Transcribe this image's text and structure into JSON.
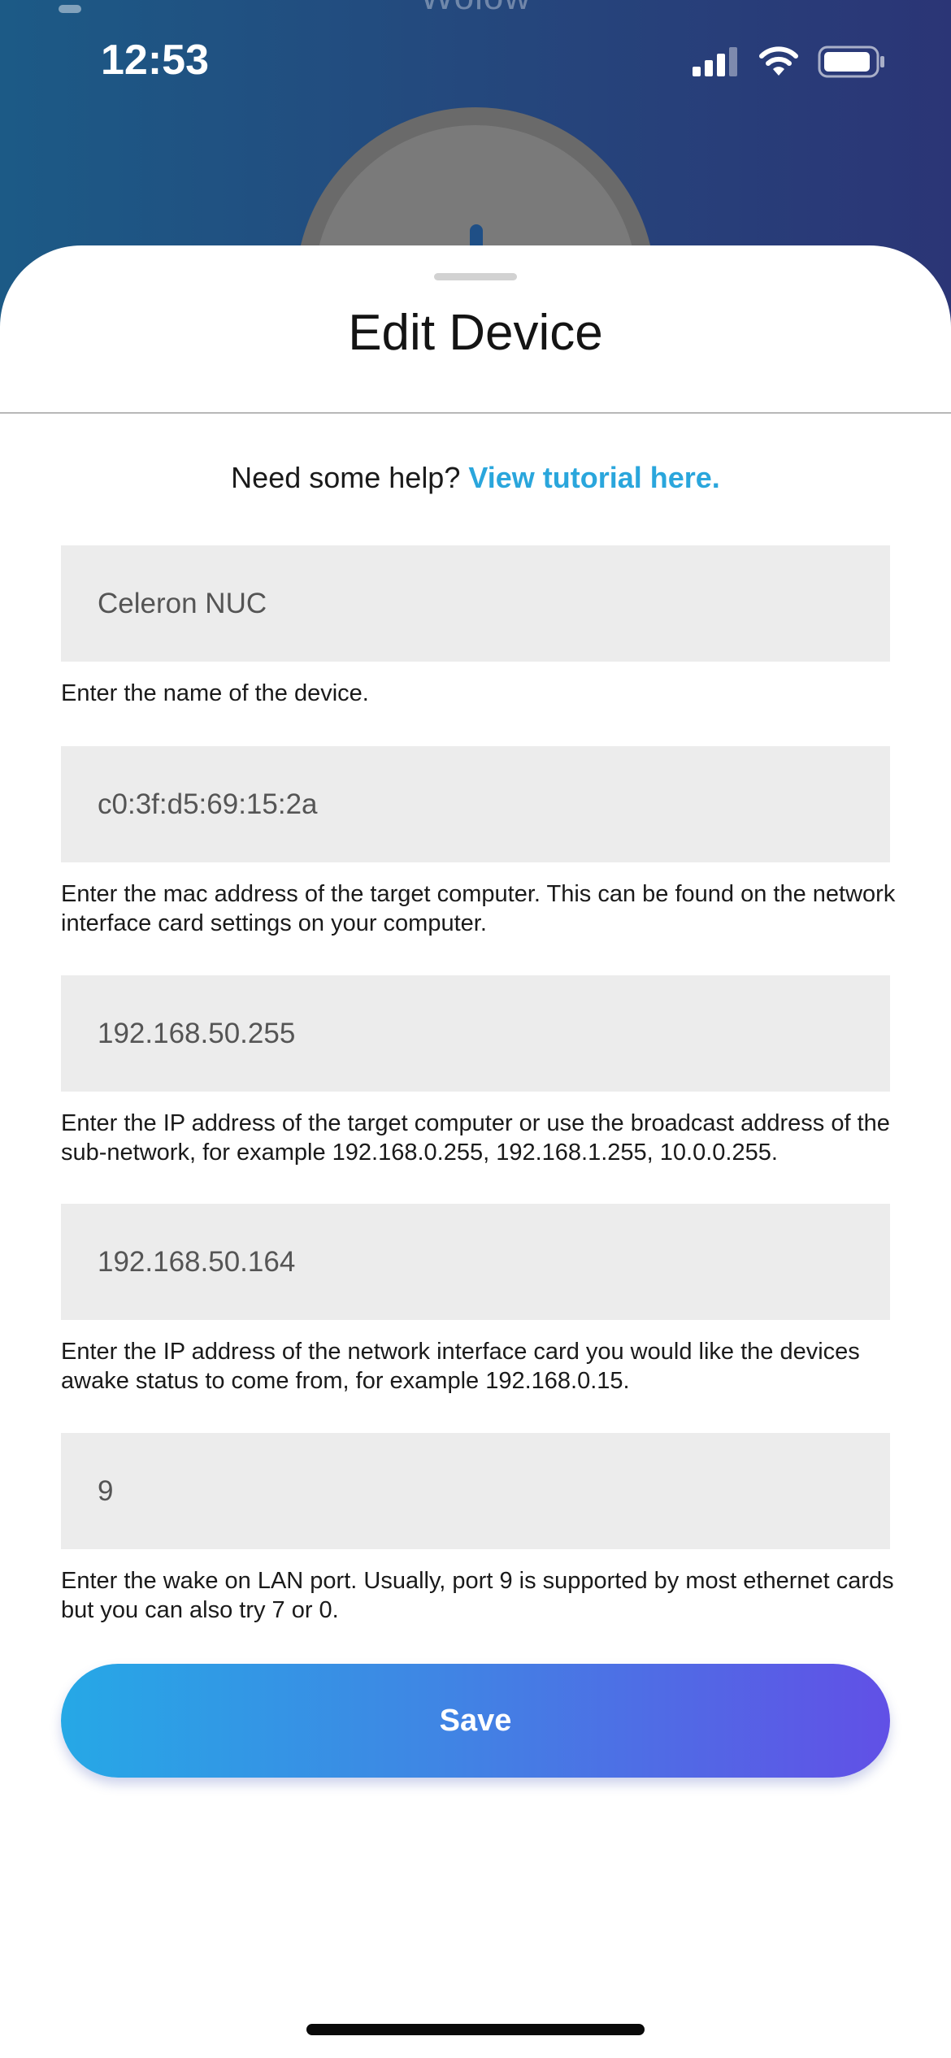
{
  "status_bar": {
    "time": "12:53"
  },
  "background": {
    "app_title": "Wolow"
  },
  "sheet": {
    "title": "Edit Device",
    "help_text": "Need some help?",
    "help_link": "View tutorial here."
  },
  "fields": [
    {
      "value": "Celeron NUC",
      "hint": "Enter the name of the device."
    },
    {
      "value": "c0:3f:d5:69:15:2a",
      "hint": "Enter the mac address of the target computer. This can be found on the network interface card settings on your computer."
    },
    {
      "value": "192.168.50.255",
      "hint": "Enter the IP address of the target computer or use the broadcast address of the sub-network, for example 192.168.0.255, 192.168.1.255, 10.0.0.255."
    },
    {
      "value": "192.168.50.164",
      "hint": "Enter the IP address of the network interface card you would like the devices awake status to come from, for example 192.168.0.15."
    },
    {
      "value": "9",
      "hint": "Enter the wake on LAN port. Usually, port 9 is supported by most ethernet cards but you can also try 7 or 0."
    }
  ],
  "save_label": "Save",
  "colors": {
    "accent": "#2aa6dc",
    "button_gradient_start": "#26a8e6",
    "button_gradient_end": "#6150e6",
    "field_background": "#ececec"
  }
}
